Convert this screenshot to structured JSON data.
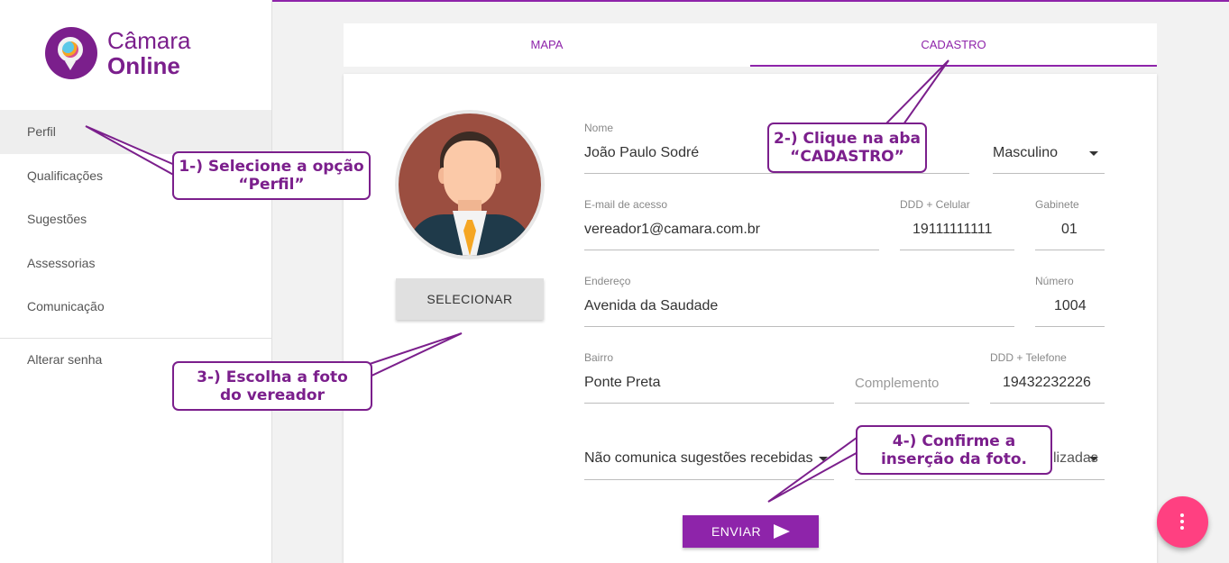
{
  "app": {
    "logo_line1": "Câmara",
    "logo_line2": "Online"
  },
  "sidebar": {
    "items": [
      {
        "label": "Perfil"
      },
      {
        "label": "Qualificações"
      },
      {
        "label": "Sugestões"
      },
      {
        "label": "Assessorias"
      },
      {
        "label": "Comunicação"
      }
    ],
    "bottom_item": "Alterar senha"
  },
  "tabs": [
    {
      "label": "MAPA"
    },
    {
      "label": "CADASTRO"
    }
  ],
  "profile": {
    "select_button": "SELECIONAR"
  },
  "form": {
    "nome_label": "Nome",
    "nome_value": "João Paulo Sodré",
    "sexo_value": "Masculino",
    "email_label": "E-mail de acesso",
    "email_value": "vereador1@camara.com.br",
    "celular_label": "DDD + Celular",
    "celular_value": "19111111111",
    "gabinete_label": "Gabinete",
    "gabinete_value": "01",
    "endereco_label": "Endereço",
    "endereco_value": "Avenida da Saudade",
    "numero_label": "Número",
    "numero_value": "1004",
    "bairro_label": "Bairro",
    "bairro_value": "Ponte Preta",
    "complemento_placeholder": "Complemento",
    "telefone_label": "DDD + Telefone",
    "telefone_value": "19432232226",
    "sugestoes_value": "Não comunica sugestões recebidas",
    "hidden_select_tail": "lizadas",
    "send_button": "ENVIAR"
  },
  "callouts": {
    "c1_line1": "1-) Selecione a opção",
    "c1_line2": "“Perfil”",
    "c2_line1": "2-) Clique na aba",
    "c2_line2": "“CADASTRO”",
    "c3_line1": "3-) Escolha a foto",
    "c3_line2": "do vereador",
    "c4_line1": "4-) Confirme a",
    "c4_line2": "inserção da foto."
  },
  "colors": {
    "accent": "#8e24aa",
    "fab": "#ff4081",
    "callout": "#7b1f8c"
  }
}
